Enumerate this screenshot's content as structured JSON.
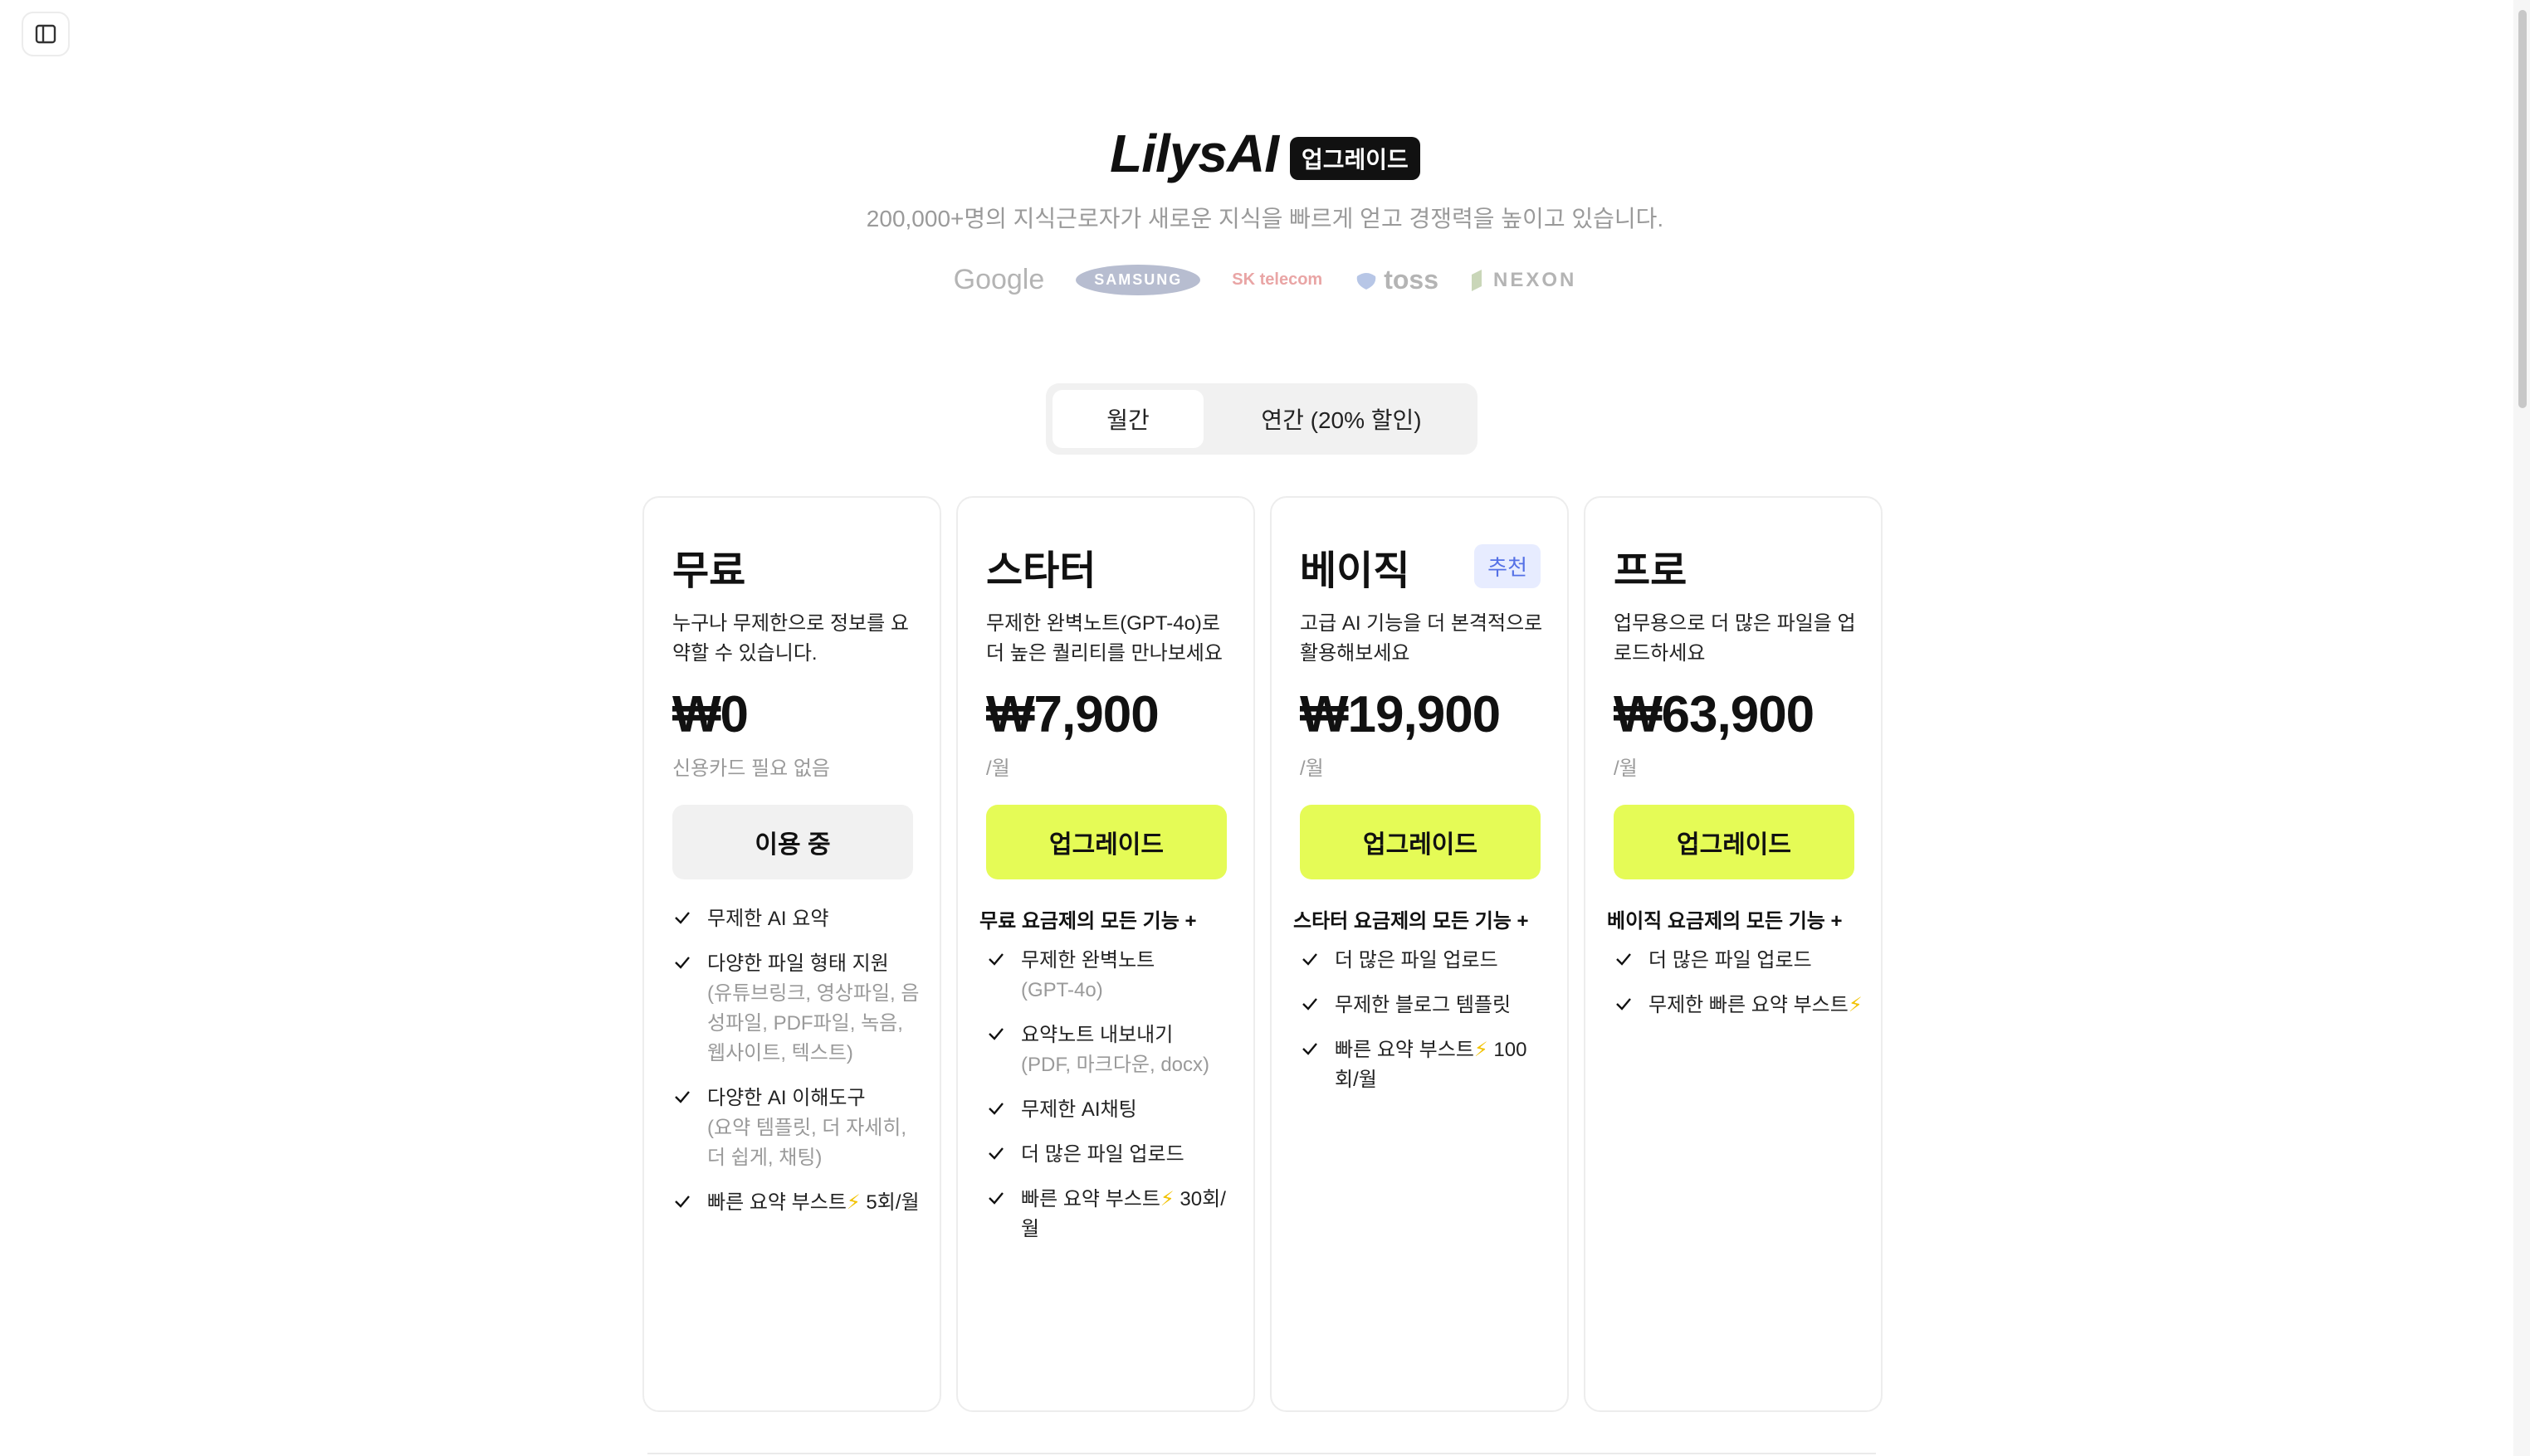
{
  "header": {
    "sidebar_icon": "sidebar-toggle-icon",
    "logo_text": "LilysAI",
    "badge": "업그레이드",
    "subtitle": "200,000+명의 지식근로자가 새로운 지식을 빠르게 얻고 경쟁력을 높이고 있습니다."
  },
  "customer_logos": [
    "Google",
    "SAMSUNG",
    "SK telecom",
    "toss",
    "NEXON"
  ],
  "billing_toggle": {
    "monthly": "월간",
    "yearly": "연간 (20% 할인)",
    "selected": "monthly"
  },
  "plans": [
    {
      "name": "무료",
      "description": "누구나 무제한으로 정보를 요약할 수 있습니다.",
      "price": "₩0",
      "price_note": "신용카드 필요 없음",
      "button": "이용 중",
      "features": [
        {
          "text": "무제한 AI 요약",
          "sub": ""
        },
        {
          "text": "다양한 파일 형태 지원",
          "sub": "(유튜브링크, 영상파일, 음성파일, PDF파일, 녹음, 웹사이트, 텍스트)"
        },
        {
          "text": "다양한 AI 이해도구",
          "sub": "(요약 템플릿, 더 자세히, 더 쉽게, 채팅)"
        },
        {
          "text": "빠른 요약 부스트⚡ 5회/월",
          "sub": ""
        }
      ]
    },
    {
      "name": "스타터",
      "description": "무제한 완벽노트(GPT-4o)로 더 높은 퀄리티를 만나보세요",
      "price": "₩7,900",
      "price_note": "/월",
      "button": "업그레이드",
      "includes": "무료 요금제의 모든 기능 +",
      "features": [
        {
          "text": "무제한 완벽노트",
          "sub": "(GPT-4o)"
        },
        {
          "text": "요약노트 내보내기",
          "sub": "(PDF, 마크다운, docx)"
        },
        {
          "text": "무제한 AI채팅",
          "sub": ""
        },
        {
          "text": "더 많은 파일 업로드",
          "sub": ""
        },
        {
          "text": "빠른 요약 부스트⚡ 30회/월",
          "sub": ""
        }
      ]
    },
    {
      "name": "베이직",
      "recommended": "추천",
      "description": "고급 AI 기능을 더 본격적으로 활용해보세요",
      "price": "₩19,900",
      "price_note": "/월",
      "button": "업그레이드",
      "includes": "스타터 요금제의 모든 기능 +",
      "features": [
        {
          "text": "더 많은 파일 업로드",
          "sub": ""
        },
        {
          "text": "무제한 블로그 템플릿",
          "sub": ""
        },
        {
          "text": "빠른 요약 부스트⚡ 100회/월",
          "sub": ""
        }
      ]
    },
    {
      "name": "프로",
      "description": "업무용으로 더 많은 파일을 업로드하세요",
      "price": "₩63,900",
      "price_note": "/월",
      "button": "업그레이드",
      "includes": "베이직 요금제의 모든 기능 +",
      "features": [
        {
          "text": "더 많은 파일 업로드",
          "sub": ""
        },
        {
          "text": "무제한 빠른 요약 부스트⚡",
          "sub": ""
        }
      ]
    }
  ],
  "colors": {
    "accent": "#e5fb56",
    "recommended_bg": "#e7ecff",
    "recommended_text": "#5470e6",
    "muted_text": "#9a9a9a"
  }
}
